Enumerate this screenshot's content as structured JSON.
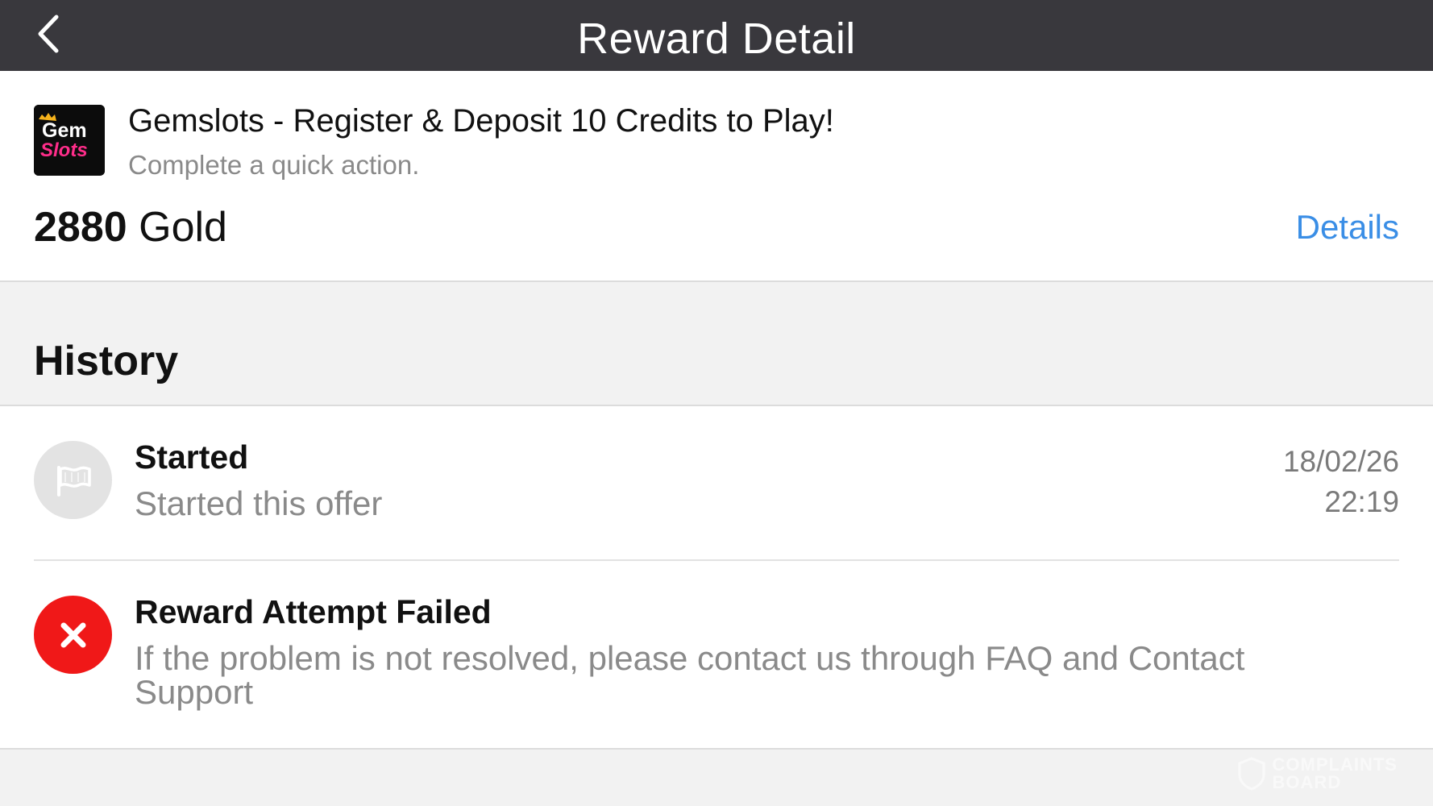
{
  "header": {
    "title": "Reward Detail",
    "back_icon": "chevron-left-icon"
  },
  "offer": {
    "logo_line1": "Gem",
    "logo_line2": "Slots",
    "title": "Gemslots - Register & Deposit 10 Credits to Play!",
    "subtitle": "Complete a quick action.",
    "reward_amount": "2880",
    "reward_unit": "Gold",
    "details_label": "Details"
  },
  "history": {
    "label": "History",
    "items": [
      {
        "icon": "flag-icon",
        "title": "Started",
        "description": "Started this offer",
        "date": "18/02/26",
        "time": "22:19"
      },
      {
        "icon": "close-icon",
        "title": "Reward Attempt Failed",
        "description": "If the problem is not resolved, please contact us through FAQ and Contact Support"
      }
    ]
  },
  "watermark": {
    "line1": "COMPLAINTS",
    "line2": "BOARD"
  },
  "colors": {
    "header_bg": "#39383d",
    "link": "#3a8ee6",
    "error": "#f01818",
    "logo_pink": "#ff2d8a"
  }
}
